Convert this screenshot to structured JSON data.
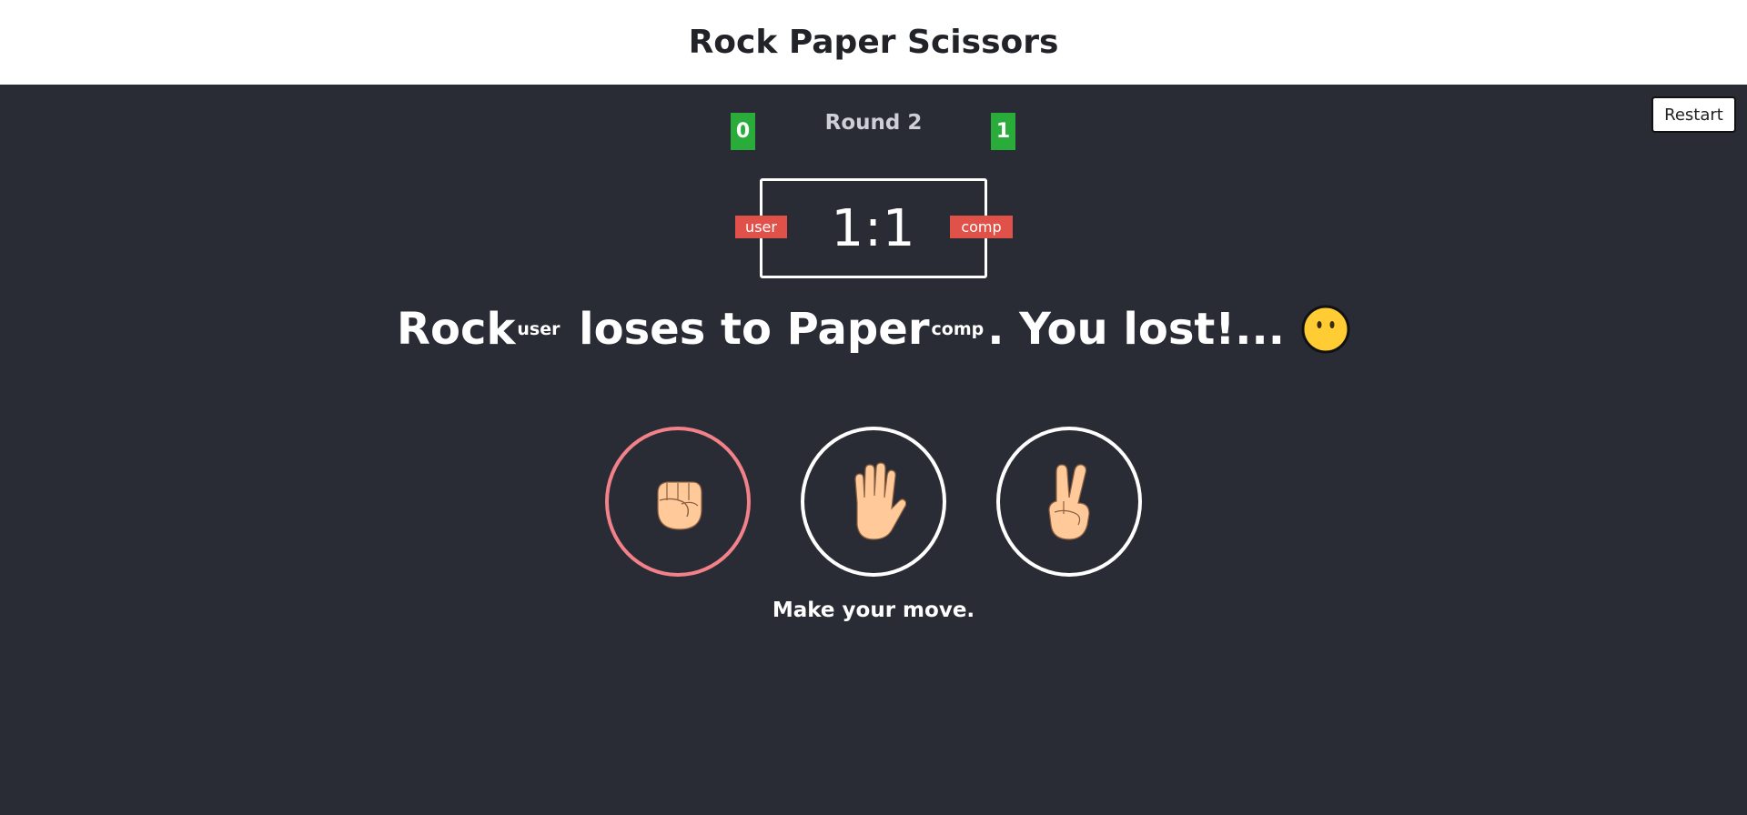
{
  "header": {
    "title": "Rock Paper Scissors"
  },
  "controls": {
    "restart_label": "Restart"
  },
  "round": {
    "label": "Round 2"
  },
  "wins": {
    "user": "0",
    "comp": "1"
  },
  "score": {
    "display": "1:1",
    "user_tag": "user",
    "comp_tag": "comp"
  },
  "result": {
    "user_move": "Rock",
    "user_sub": "user",
    "verb": " loses to ",
    "comp_move": "Paper",
    "comp_sub": "comp",
    "outcome": ". You lost!...",
    "emoji_icon": "neutral-face-icon"
  },
  "choices": [
    {
      "name": "rock",
      "icon": "raised-fist-icon",
      "selected": true
    },
    {
      "name": "paper",
      "icon": "raised-hand-icon",
      "selected": false
    },
    {
      "name": "scissors",
      "icon": "victory-hand-icon",
      "selected": false
    }
  ],
  "prompt": {
    "text": "Make your move."
  },
  "colors": {
    "background": "#2a2c35",
    "header_bg": "#ffffff",
    "win_badge": "#2aac3b",
    "tag": "#e0514a",
    "selected_ring": "#f28189",
    "skin": "#ffc99a"
  }
}
